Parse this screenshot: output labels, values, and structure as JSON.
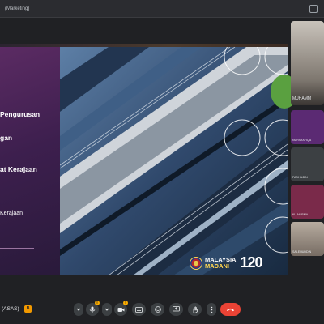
{
  "window": {
    "title": "(Marketing)"
  },
  "slide": {
    "lines": [
      "Pengurusan",
      "gan",
      "at Kerajaan",
      "Kerajaan"
    ],
    "logo_text_1": "MALAYSIA",
    "logo_text_2": "MADANI",
    "logo_number": "120"
  },
  "participants": [
    {
      "name": "MUHAMM"
    },
    {
      "name": "NURSYAFIQA"
    },
    {
      "name": "FADHILDIN"
    },
    {
      "name": "KU NURMA"
    },
    {
      "name": "SALEHUDDIN"
    }
  ],
  "bottom": {
    "meeting_name": "(ASAS)",
    "doc_badge": "B"
  },
  "controls": [
    {
      "icon": "dropdown-arrow-icon"
    },
    {
      "icon": "microphone-icon"
    },
    {
      "icon": "camera-icon"
    },
    {
      "icon": "present-screen-icon"
    },
    {
      "icon": "emoji-icon"
    },
    {
      "icon": "captions-icon"
    },
    {
      "icon": "raise-hand-icon"
    },
    {
      "icon": "more-options-icon"
    },
    {
      "icon": "hang-up-icon"
    }
  ],
  "colors": {
    "hangup": "#ea4335",
    "warning": "#f9ab00",
    "slide_purple": "#5b2b63"
  }
}
